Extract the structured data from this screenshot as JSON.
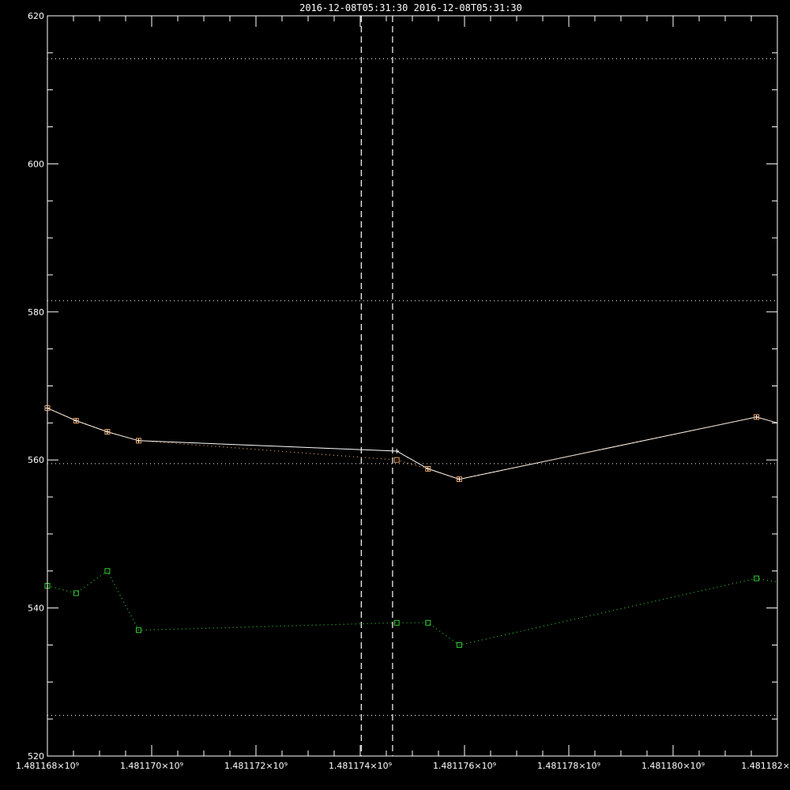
{
  "colors": {
    "background": "#000000",
    "axis": "#ffffff",
    "series_white": "#ffffff",
    "series_orange": "#e8a060",
    "series_green": "#33cc33",
    "reference_lines": "#ffffff"
  },
  "chart_data": {
    "type": "line",
    "title": "2016-12-08T05:31:30   2016-12-08T05:31:30",
    "xlabel": "",
    "ylabel": "",
    "xlim": [
      1481168000,
      1481182000
    ],
    "ylim": [
      520,
      620
    ],
    "x_ticks": [
      {
        "value": 1481168000,
        "label": "1.481168×10⁹"
      },
      {
        "value": 1481170000,
        "label": "1.481170×10⁹"
      },
      {
        "value": 1481172000,
        "label": "1.481172×10⁹"
      },
      {
        "value": 1481174000,
        "label": "1.481174×10⁹"
      },
      {
        "value": 1481176000,
        "label": "1.481176×10⁹"
      },
      {
        "value": 1481178000,
        "label": "1.481178×10⁹"
      },
      {
        "value": 1481180000,
        "label": "1.481180×10⁹"
      },
      {
        "value": 1481182000,
        "label": "1.481182×"
      }
    ],
    "y_ticks": [
      {
        "value": 520,
        "label": "520"
      },
      {
        "value": 540,
        "label": "540"
      },
      {
        "value": 560,
        "label": "560"
      },
      {
        "value": 580,
        "label": "580"
      },
      {
        "value": 600,
        "label": "600"
      },
      {
        "value": 620,
        "label": "620"
      }
    ],
    "y_minor_step": 5,
    "x_minor_step": 500,
    "vertical_markers": [
      1481174020,
      1481174620
    ],
    "horizontal_reference_lines": [
      525.5,
      559.5,
      581.5,
      614.2
    ],
    "series": [
      {
        "style": "solid-cross",
        "color_key": "series_white",
        "x": [
          1481168000,
          1481168550,
          1481169150,
          1481169750,
          1481174700,
          1481175300,
          1481175900,
          1481181600,
          1481182000
        ],
        "y": [
          567.0,
          565.3,
          563.8,
          562.6,
          561.2,
          558.8,
          557.4,
          565.8,
          565.0
        ]
      },
      {
        "style": "dotted-square",
        "color_key": "series_orange",
        "x": [
          1481168000,
          1481168550,
          1481169150,
          1481169750,
          1481174700,
          1481175300,
          1481175900,
          1481181600,
          1481182000
        ],
        "y": [
          567.0,
          565.3,
          563.8,
          562.6,
          560.0,
          558.8,
          557.4,
          565.8,
          565.0
        ]
      },
      {
        "style": "dotted-square",
        "color_key": "series_green",
        "x": [
          1481168000,
          1481168550,
          1481169150,
          1481169750,
          1481174700,
          1481175300,
          1481175900,
          1481181600,
          1481182000
        ],
        "y": [
          543.0,
          542.0,
          545.0,
          537.0,
          538.0,
          538.0,
          535.0,
          544.0,
          543.5
        ]
      }
    ]
  }
}
